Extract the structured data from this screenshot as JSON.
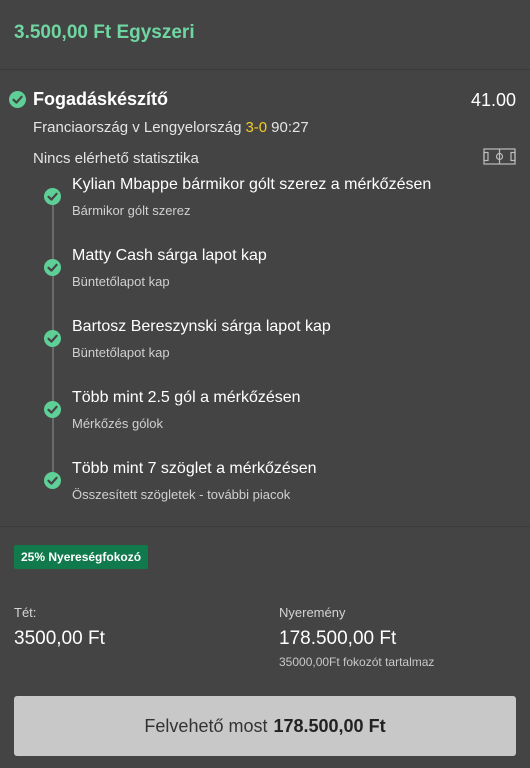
{
  "header": {
    "title": "3.500,00 Ft Egyszeri"
  },
  "bet": {
    "type": "Fogadáskészítő",
    "odds": "41.00",
    "match": "Franciaország v Lengyelország",
    "score": "3-0",
    "time": "90:27",
    "stats_text": "Nincs elérhető statisztika",
    "legs": [
      {
        "title": "Kylian Mbappe bármikor gólt szerez a mérkőzésen",
        "market": "Bármikor gólt szerez"
      },
      {
        "title": "Matty Cash sárga lapot kap",
        "market": "Büntetőlapot kap"
      },
      {
        "title": "Bartosz Bereszynski sárga lapot kap",
        "market": "Büntetőlapot kap"
      },
      {
        "title": "Több mint 2.5 gól a mérkőzésen",
        "market": "Mérkőzés gólok"
      },
      {
        "title": "Több mint 7 szöglet a mérkőzésen",
        "market": "Összesített szögletek - további piacok"
      }
    ]
  },
  "boost": {
    "label": "25% Nyereségfokozó"
  },
  "stake": {
    "label": "Tét:",
    "value": "3500,00 Ft"
  },
  "returns": {
    "label": "Nyeremény",
    "value": "178.500,00 Ft",
    "note": "35000,00Ft fokozót tartalmaz"
  },
  "cashout": {
    "label": "Felvehető most",
    "amount": "178.500,00 Ft"
  },
  "colors": {
    "background": "#444444",
    "accent_green": "#6fd6a2",
    "check_green": "#5ecf96",
    "score_yellow": "#f4cc24",
    "badge_green": "#117a4d",
    "button_grey": "#c8c8c8"
  },
  "icons": {
    "settled": "check-circle-icon",
    "stats": "football-pitch-icon"
  }
}
